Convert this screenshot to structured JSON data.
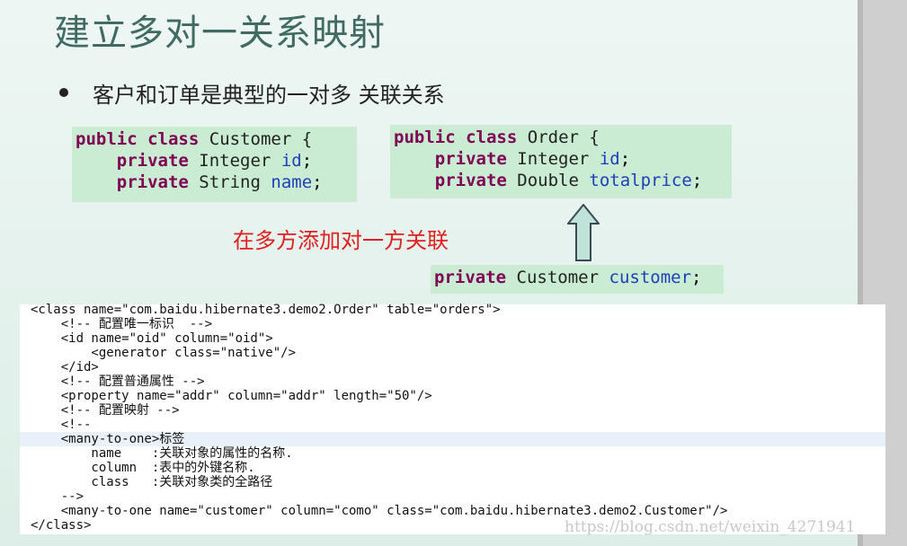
{
  "slide": {
    "title": "建立多对一关系映射",
    "bullet": "客户和订单是典型的一对多 关联关系",
    "note": "在多方添加对一方关联"
  },
  "customer_class": {
    "kw1": "public",
    "kw2": "class",
    "name": "Customer {",
    "fields": [
      {
        "mod": "private",
        "type": "Integer",
        "name": "id",
        "end": ";"
      },
      {
        "mod": "private",
        "type": "String",
        "name": "name",
        "end": ";"
      }
    ]
  },
  "order_class": {
    "kw1": "public",
    "kw2": "class",
    "name": "Order {",
    "fields": [
      {
        "mod": "private",
        "type": "Integer",
        "name": "id",
        "end": ";"
      },
      {
        "mod": "private",
        "type": "Double",
        "name": "totalprice",
        "end": ";"
      }
    ]
  },
  "added_field": {
    "mod": "private",
    "type": "Customer",
    "name": "customer",
    "end": ";"
  },
  "xml_lines": [
    "<class name=\"com.baidu.hibernate3.demo2.Order\" table=\"orders\">",
    "    <!-- 配置唯一标识  -->",
    "    <id name=\"oid\" column=\"oid\">",
    "        <generator class=\"native\"/>",
    "    </id>",
    "    <!-- 配置普通属性 -->",
    "    <property name=\"addr\" column=\"addr\" length=\"50\"/>",
    "    <!-- 配置映射 -->",
    "    <!--",
    "    <many-to-one>标签",
    "        name    :关联对象的属性的名称.",
    "        column  :表中的外键名称.",
    "        class   :关联对象类的全路径",
    "    -->",
    "    <many-to-one name=\"customer\" column=\"como\" class=\"com.baidu.hibernate3.demo2.Customer\"/>",
    "</class>"
  ],
  "watermark": "https://blog.csdn.net/weixin_4271941",
  "colors": {
    "keyword": "#7f0055",
    "field": "#1f3fb8",
    "note": "#e0201f",
    "code_bg": "#c9ecd3"
  }
}
